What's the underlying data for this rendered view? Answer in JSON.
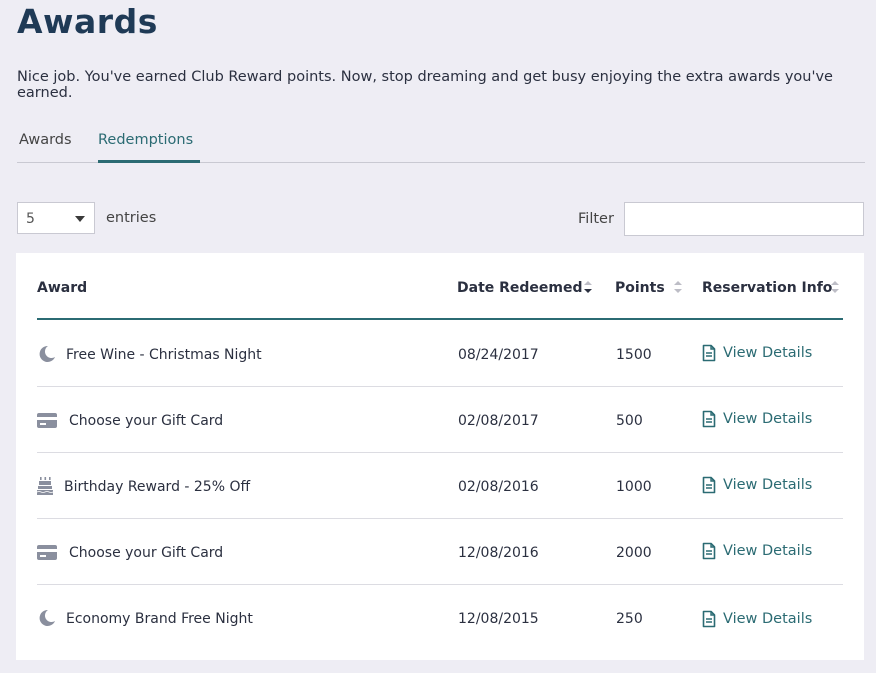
{
  "page": {
    "title": "Awards",
    "intro": "Nice job. You've earned Club Reward points. Now, stop dreaming and get busy enjoying the extra awards you've earned."
  },
  "tabs": [
    {
      "label": "Awards",
      "active": false
    },
    {
      "label": "Redemptions",
      "active": true
    }
  ],
  "controls": {
    "page_length": "5",
    "entries_label": "entries",
    "filter_label": "Filter",
    "filter_value": ""
  },
  "table": {
    "columns": {
      "award": "Award",
      "date": "Date Redeemed",
      "points": "Points",
      "reservation": "Reservation Info"
    },
    "sort": {
      "column": "date",
      "direction": "desc"
    },
    "rows": [
      {
        "icon": "moon-icon",
        "award": "Free Wine - Christmas Night",
        "date": "08/24/2017",
        "points": "1500",
        "link": "View Details"
      },
      {
        "icon": "credit-card-icon",
        "award": "Choose your Gift Card",
        "date": "02/08/2017",
        "points": "500",
        "link": "View Details"
      },
      {
        "icon": "birthday-cake-icon",
        "award": "Birthday Reward - 25% Off",
        "date": "02/08/2016",
        "points": "1000",
        "link": "View Details"
      },
      {
        "icon": "credit-card-icon",
        "award": "Choose your Gift Card",
        "date": "12/08/2016",
        "points": "2000",
        "link": "View Details"
      },
      {
        "icon": "moon-icon",
        "award": "Economy Brand Free Night",
        "date": "12/08/2015",
        "points": "250",
        "link": "View Details"
      }
    ]
  },
  "colors": {
    "background": "#eeedf4",
    "accent": "#2b6b73",
    "title": "#1f3a56",
    "icon_gray": "#8a8f9e"
  }
}
